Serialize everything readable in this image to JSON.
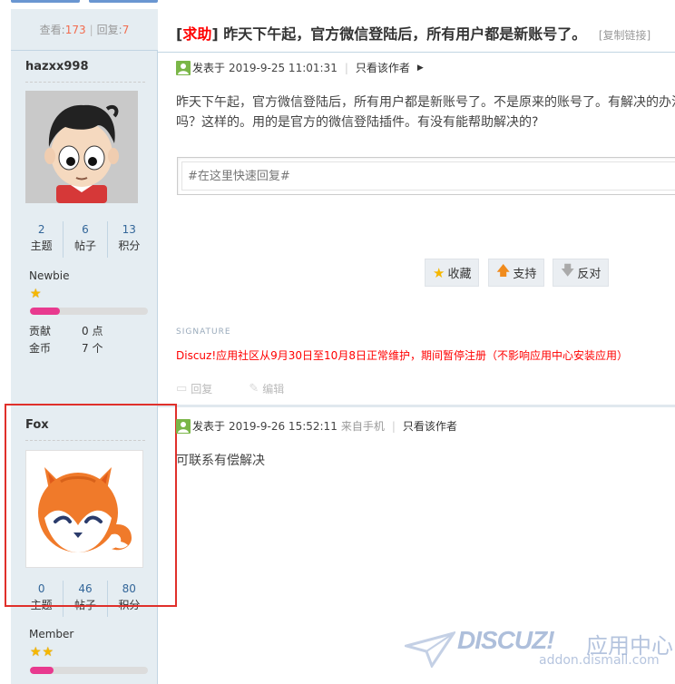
{
  "thread": {
    "views_label": "查看:",
    "views": "173",
    "replies_label": "回复:",
    "replies": "7",
    "tag_open": "[",
    "tag": "求助",
    "tag_close": "]",
    "title": "昨天下午起，官方微信登陆后，所有用户都是新账号了。",
    "copy_link": "[复制链接]"
  },
  "posts": [
    {
      "author": "hazxx998",
      "stats": [
        {
          "value": "2",
          "label": "主题"
        },
        {
          "value": "6",
          "label": "帖子"
        },
        {
          "value": "13",
          "label": "积分"
        }
      ],
      "level": "Newbie",
      "stars": "★",
      "level_progress": 0.25,
      "extra": [
        {
          "key": "贡献",
          "value": "0 点"
        },
        {
          "key": "金币",
          "value": "7 个"
        }
      ],
      "posted_label": "发表于",
      "date": "2019-9-25 11:01:31",
      "only_author": "只看该作者",
      "body": "昨天下午起，官方微信登陆后，所有用户都是新账号了。不是原来的账号了。有解决的办法吗？这样的。用的是官方的微信登陆插件。有没有能帮助解决的?",
      "quick_reply_placeholder": "#在这里快速回复#",
      "buttons": {
        "favorite": "收藏",
        "support": "支持",
        "oppose": "反对"
      },
      "signature_label": "SIGNATURE",
      "signature": "Discuz!应用社区从9月30日至10月8日正常维护，期间暂停注册（不影响应用中心安装应用）",
      "reply": "回复",
      "edit": "编辑"
    },
    {
      "author": "Fox",
      "stats": [
        {
          "value": "0",
          "label": "主题"
        },
        {
          "value": "46",
          "label": "帖子"
        },
        {
          "value": "80",
          "label": "积分"
        }
      ],
      "level": "Member",
      "stars": "★★",
      "level_progress": 0.2,
      "posted_label": "发表于",
      "date": "2019-9-26 15:52:11",
      "from": "来自手机",
      "only_author": "只看该作者",
      "body": "可联系有偿解决"
    }
  ],
  "watermark": {
    "brand": "DISCUZ!",
    "cn": "应用中心",
    "url": "addon.dismall.com"
  },
  "colors": {
    "sidebar": "#e5edf2",
    "highlight": "#e0302b",
    "tag": "#ff0000",
    "signature": "#ff0000"
  }
}
